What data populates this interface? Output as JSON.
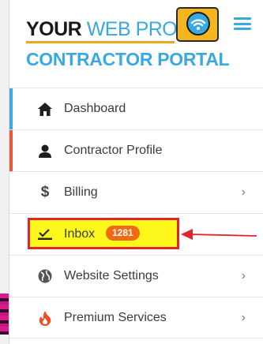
{
  "brand": {
    "line1_bold": "YOUR",
    "line1_light": "WEB PRO",
    "line2": "CONTRACTOR PORTAL",
    "primary_color": "#3aa9df",
    "accent_color": "#f5b51c"
  },
  "header": {
    "menu_icon": "hamburger-icon"
  },
  "menu": {
    "items": [
      {
        "id": "dashboard",
        "label": "Dashboard",
        "icon": "home-icon",
        "accent": "#3aa9df",
        "has_chevron": false
      },
      {
        "id": "contractor-profile",
        "label": "Contractor Profile",
        "icon": "user-icon",
        "accent": "#e9573f",
        "has_chevron": false
      },
      {
        "id": "billing",
        "label": "Billing",
        "icon": "dollar-icon",
        "has_chevron": true
      },
      {
        "id": "inbox",
        "label": "Inbox",
        "icon": "inbox-icon",
        "badge": "1281",
        "highlighted": true,
        "has_chevron": false
      },
      {
        "id": "website-settings",
        "label": "Website Settings",
        "icon": "globe-icon",
        "has_chevron": true
      },
      {
        "id": "premium-services",
        "label": "Premium Services",
        "icon": "fire-icon",
        "has_chevron": true
      }
    ],
    "chevron_glyph": "›"
  },
  "annotation": {
    "highlight_color": "#e0262b",
    "fill_color": "#fdf71b"
  }
}
